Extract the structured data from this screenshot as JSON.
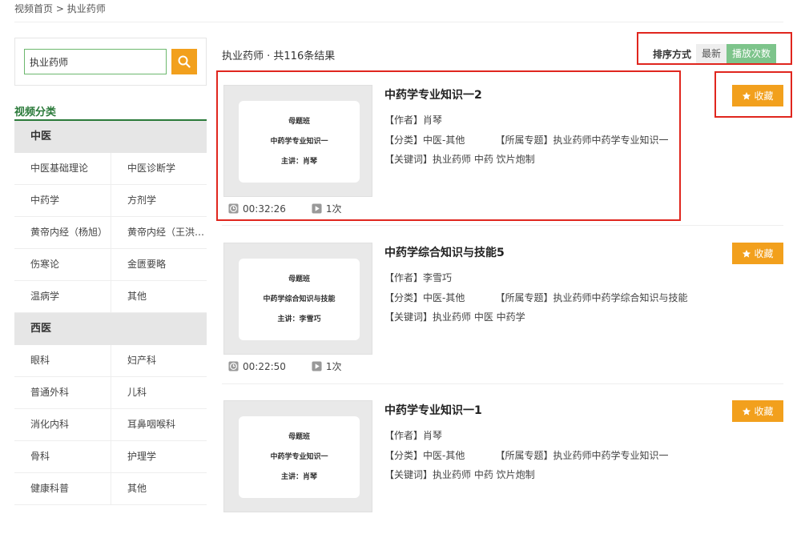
{
  "breadcrumb": {
    "home": "视频首页",
    "sep": ">",
    "current": "执业药师"
  },
  "search": {
    "value": "执业药师"
  },
  "categories": {
    "title": "视频分类",
    "groups": [
      {
        "name": "中医",
        "rows": [
          [
            "中医基础理论",
            "中医诊断学"
          ],
          [
            "中药学",
            "方剂学"
          ],
          [
            "黄帝内经（杨旭）",
            "黄帝内经（王洪图）"
          ],
          [
            "伤寒论",
            "金匮要略"
          ],
          [
            "温病学",
            "其他"
          ]
        ]
      },
      {
        "name": "西医",
        "rows": [
          [
            "眼科",
            "妇产科"
          ],
          [
            "普通外科",
            "儿科"
          ],
          [
            "消化内科",
            "耳鼻咽喉科"
          ],
          [
            "骨科",
            "护理学"
          ],
          [
            "健康科普",
            "其他"
          ]
        ]
      }
    ]
  },
  "results": {
    "heading": "执业药师 · 共116条结果"
  },
  "sort": {
    "label": "排序方式",
    "newest": "最新",
    "plays": "播放次数"
  },
  "items": [
    {
      "title": "中药学专业知识一2",
      "author": "【作者】肖琴",
      "category": "【分类】中医-其他",
      "topic": "【所属专题】执业药师中药学专业知识一",
      "keywords": "【关键词】执业药师  中药  饮片炮制",
      "duration": "00:32:26",
      "plays": "1次",
      "fav": "收藏",
      "thumb": {
        "line1": "母题班",
        "line2": "中药学专业知识一",
        "line3": "主讲：肖琴"
      }
    },
    {
      "title": "中药学综合知识与技能5",
      "author": "【作者】李雪巧",
      "category": "【分类】中医-其他",
      "topic": "【所属专题】执业药师中药学综合知识与技能",
      "keywords": "【关键词】执业药师  中医  中药学",
      "duration": "00:22:50",
      "plays": "1次",
      "fav": "收藏",
      "thumb": {
        "line1": "母题班",
        "line2": "中药学综合知识与技能",
        "line3": "主讲：李雪巧"
      }
    },
    {
      "title": "中药学专业知识一1",
      "author": "【作者】肖琴",
      "category": "【分类】中医-其他",
      "topic": "【所属专题】执业药师中药学专业知识一",
      "keywords": "【关键词】执业药师  中药  饮片炮制",
      "duration": "",
      "plays": "",
      "fav": "收藏",
      "thumb": {
        "line1": "母题班",
        "line2": "中药学专业知识一",
        "line3": "主讲：肖琴"
      }
    }
  ],
  "colors": {
    "accent": "#f2a01d",
    "green": "#2b7a3a",
    "sort_active": "#7dc48b",
    "highlight": "#e0261e"
  }
}
